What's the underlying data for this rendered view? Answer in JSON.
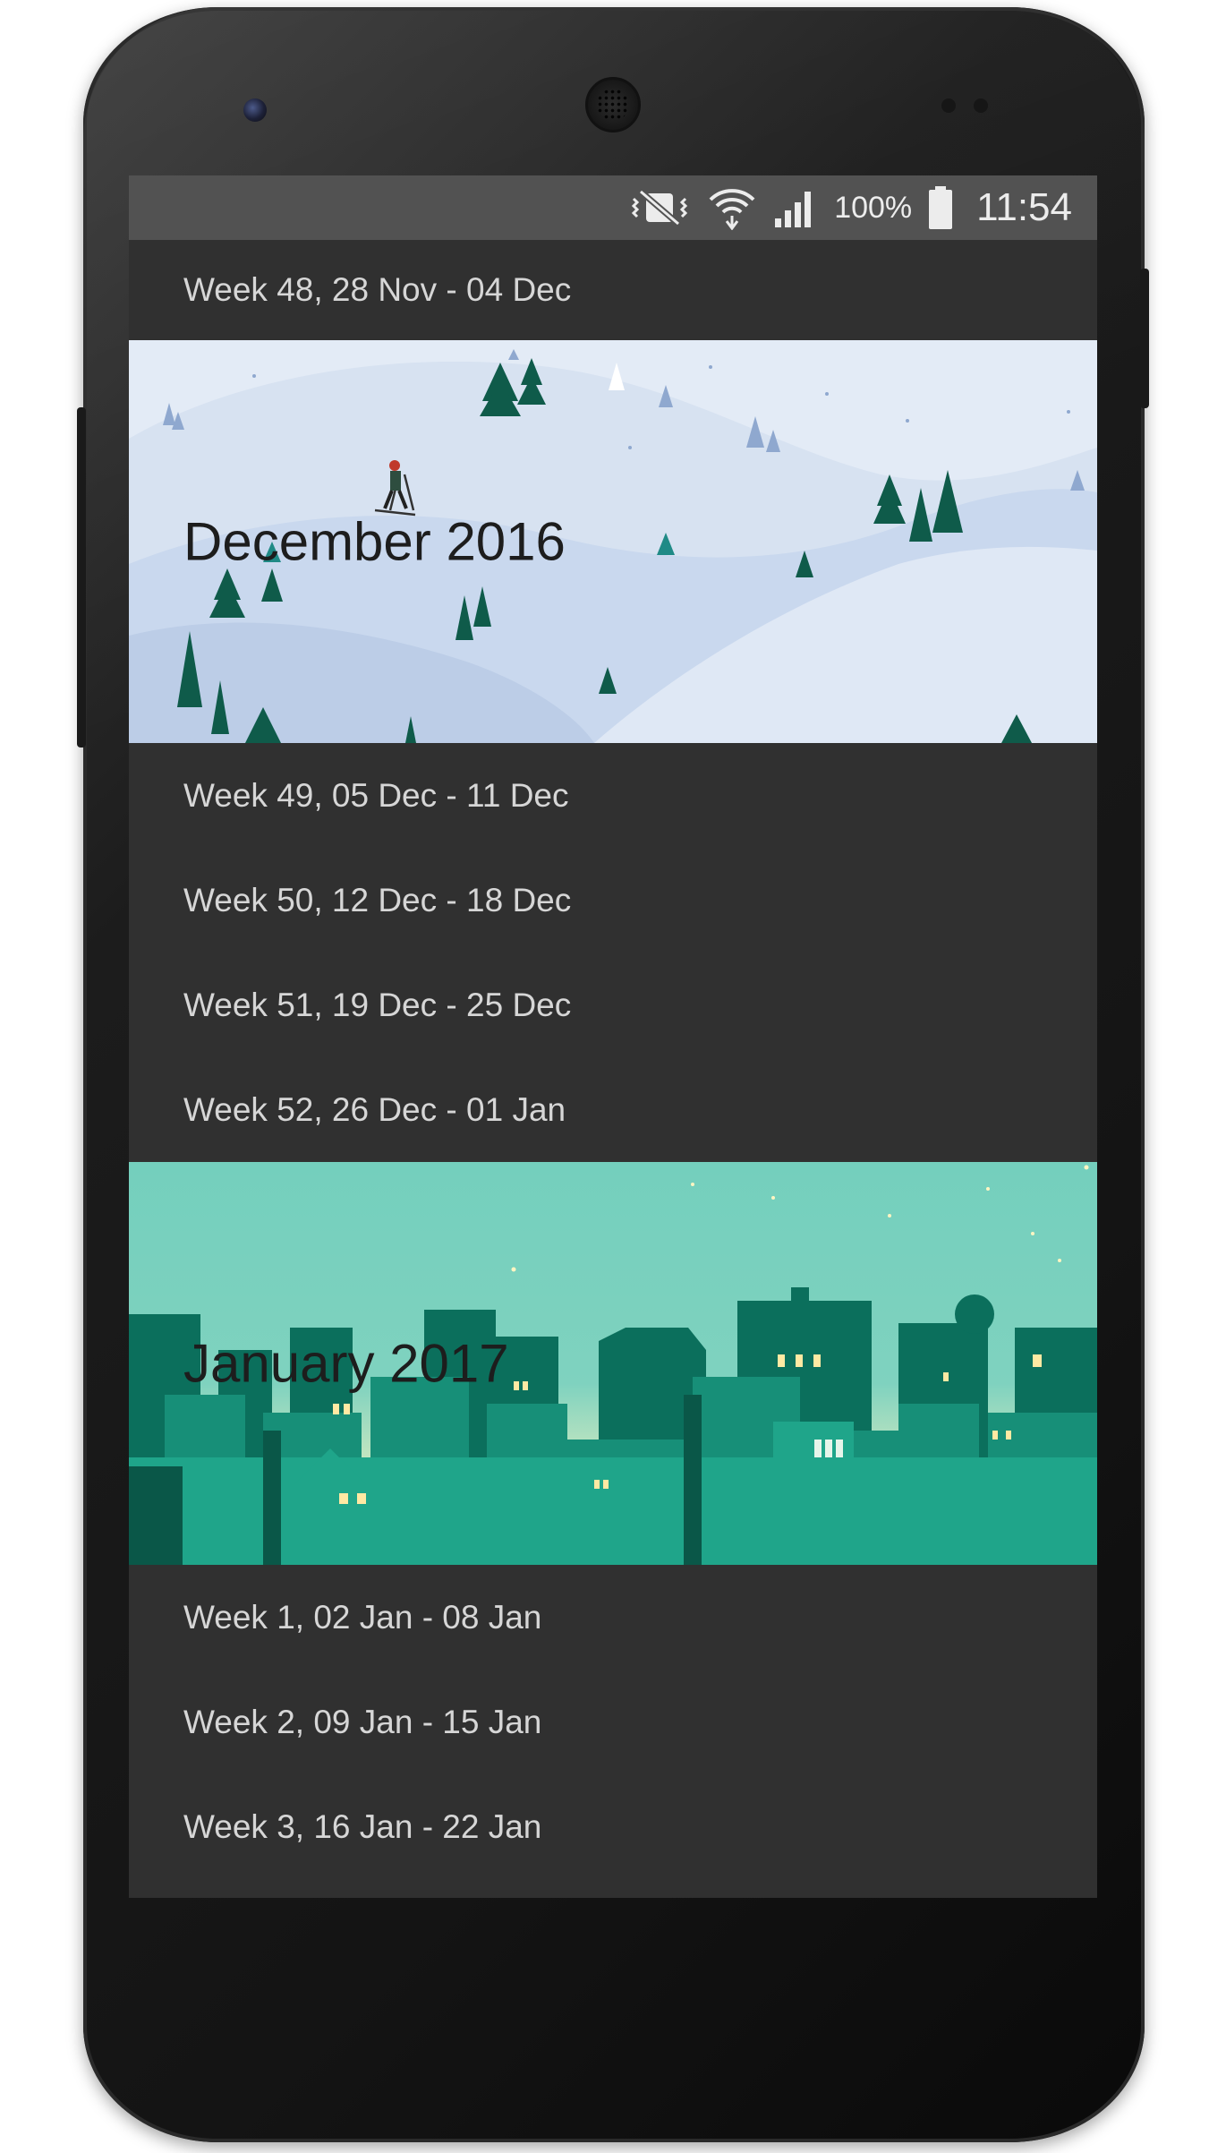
{
  "status_bar": {
    "icons": [
      "vibrate-icon",
      "wifi-icon",
      "signal-icon",
      "battery-icon"
    ],
    "battery_percent": "100%",
    "time": "11:54"
  },
  "agenda": [
    {
      "kind": "week",
      "label": "Week 48, 28 Nov - 04 Dec"
    },
    {
      "kind": "month",
      "label": "December 2016",
      "theme": "winter-hills"
    },
    {
      "kind": "week",
      "label": "Week 49, 05 Dec - 11 Dec"
    },
    {
      "kind": "week",
      "label": "Week 50, 12 Dec - 18 Dec"
    },
    {
      "kind": "week",
      "label": "Week 51, 19 Dec - 25 Dec"
    },
    {
      "kind": "week",
      "label": "Week 52, 26 Dec - 01 Jan"
    },
    {
      "kind": "month",
      "label": "January 2017",
      "theme": "teal-city"
    },
    {
      "kind": "week",
      "label": "Week 1, 02 Jan - 08 Jan"
    },
    {
      "kind": "week",
      "label": "Week 2, 09 Jan - 15 Jan"
    },
    {
      "kind": "week",
      "label": "Week 3, 16 Jan - 22 Jan"
    }
  ],
  "colors": {
    "screen_bg": "#303030",
    "status_bar_bg": "#525252",
    "row_text": "#d6d6d6",
    "winter_sky": "#dfe8f4",
    "teal_sky": "#74cfbd"
  }
}
